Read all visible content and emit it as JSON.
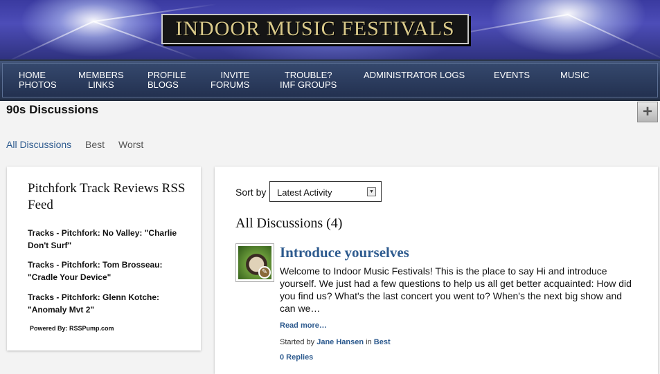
{
  "header": {
    "logo_text": "INDOOR MUSIC FESTIVALS"
  },
  "nav": {
    "items": [
      {
        "line1": "HOME",
        "line2": "PHOTOS"
      },
      {
        "line1": "MEMBERS",
        "line2": "LINKS"
      },
      {
        "line1": "PROFILE",
        "line2": "BLOGS"
      },
      {
        "line1": "INVITE",
        "line2": "FORUMS"
      },
      {
        "line1": "TROUBLE?",
        "line2": "IMF GROUPS"
      },
      {
        "line1": "ADMINISTRATOR LOGS",
        "line2": ""
      },
      {
        "line1": "EVENTS",
        "line2": ""
      },
      {
        "line1": "MUSIC",
        "line2": ""
      }
    ]
  },
  "page": {
    "title": "90s Discussions",
    "add_icon": "plus-icon"
  },
  "tabs": [
    {
      "label": "All Discussions",
      "active": true
    },
    {
      "label": "Best",
      "active": false
    },
    {
      "label": "Worst",
      "active": false
    }
  ],
  "sidebar": {
    "title": "Pitchfork Track Reviews RSS Feed",
    "items": [
      "Tracks - Pitchfork: No Valley: \"Charlie Don't Surf\"",
      "Tracks - Pitchfork: Tom Brosseau: \"Cradle Your Device\"",
      "Tracks - Pitchfork: Glenn Kotche: \"Anomaly Mvt 2\""
    ],
    "powered_by": "Powered By: RSSPump.com"
  },
  "main": {
    "sort_label": "Sort by",
    "sort_value": "Latest Activity",
    "heading": "All Discussions (4)",
    "discussion": {
      "title": "Introduce yourselves",
      "excerpt": "Welcome to Indoor Music Festivals! This is the place to say Hi and introduce yourself. We just had a few questions to help us all get better acquainted: How did you find us? What's the last concert you went to? When's the next big show and can we…",
      "read_more": "Read more…",
      "started_by_prefix": "Started by",
      "author": "Jane Hansen",
      "in_word": "in",
      "category": "Best",
      "replies": "0 Replies"
    }
  },
  "colors": {
    "accent_link": "#2d5a8e",
    "nav_bg": "#2d3d5e",
    "banner_bg": "#3a3aa0"
  }
}
